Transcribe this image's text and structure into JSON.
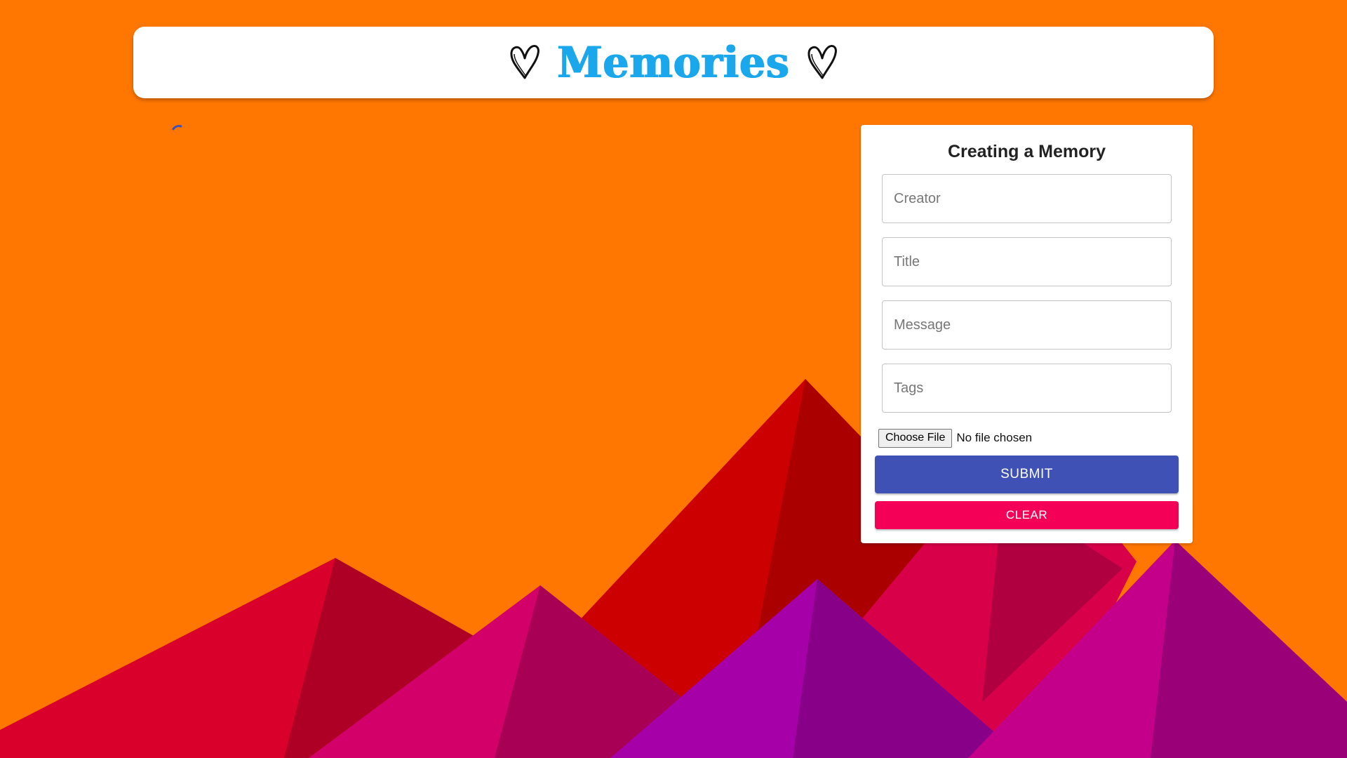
{
  "colors": {
    "background": "#ff7700",
    "brand": "#1aa7ec",
    "primary": "#3f51b5",
    "secondary": "#f50057",
    "card": "#ffffff"
  },
  "appbar": {
    "brand_text": "Memories",
    "left_icon": "heart-outline-icon",
    "right_icon": "heart-outline-icon"
  },
  "loading_indicator": "circular-progress",
  "form": {
    "title": "Creating a Memory",
    "fields": [
      {
        "name": "creator",
        "placeholder": "Creator",
        "value": ""
      },
      {
        "name": "title",
        "placeholder": "Title",
        "value": ""
      },
      {
        "name": "message",
        "placeholder": "Message",
        "value": ""
      },
      {
        "name": "tags",
        "placeholder": "Tags",
        "value": ""
      }
    ],
    "file": {
      "button_label": "Choose File",
      "status": "No file chosen"
    },
    "submit_label": "SUBMIT",
    "clear_label": "CLEAR"
  }
}
